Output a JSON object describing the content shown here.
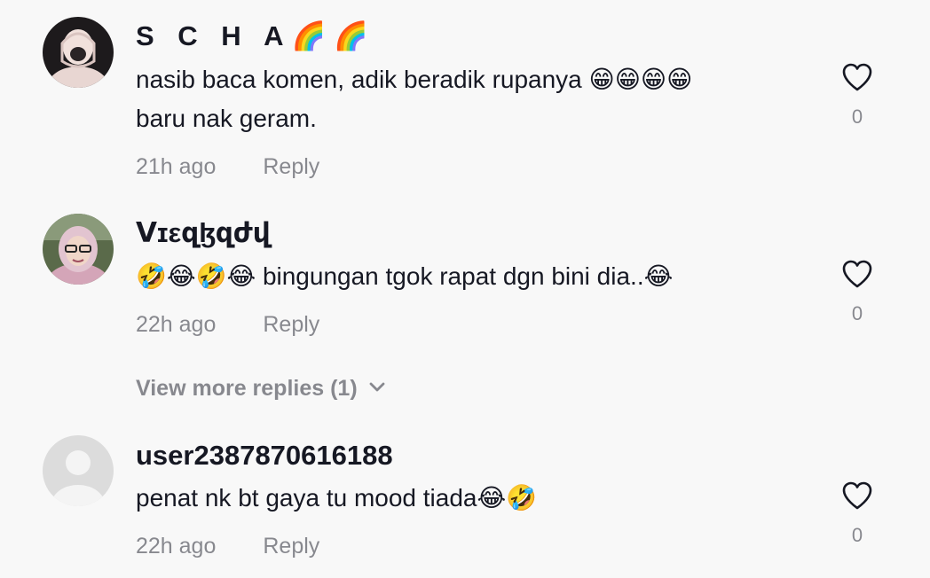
{
  "comments": [
    {
      "username": "S C H A🌈🌈",
      "text_lines": [
        "nasib baca komen, adik beradik rupanya 😁😁😁😁",
        "baru nak geram."
      ],
      "time": "21h ago",
      "reply_label": "Reply",
      "like_count": "0",
      "avatar_icon": "user-avatar-hijab-photo"
    },
    {
      "username": "ᐯɪεզɮզժվ",
      "text_lines": [
        "🤣😂🤣😂 bingungan tgok rapat dgn bini dia..😂"
      ],
      "time": "22h ago",
      "reply_label": "Reply",
      "like_count": "0",
      "avatar_icon": "user-avatar-glasses-photo"
    },
    {
      "username": "user2387870616188",
      "text_lines": [
        "penat nk bt gaya tu mood tiada😂🤣"
      ],
      "time": "22h ago",
      "reply_label": "Reply",
      "like_count": "0",
      "avatar_icon": "default-avatar-icon"
    }
  ],
  "view_more_replies": "View more replies (1)",
  "colors": {
    "background": "#f8f8f8",
    "primary_text": "#161823",
    "secondary_text": "rgba(22,24,35,0.5)",
    "heart_outline": "#161823"
  }
}
